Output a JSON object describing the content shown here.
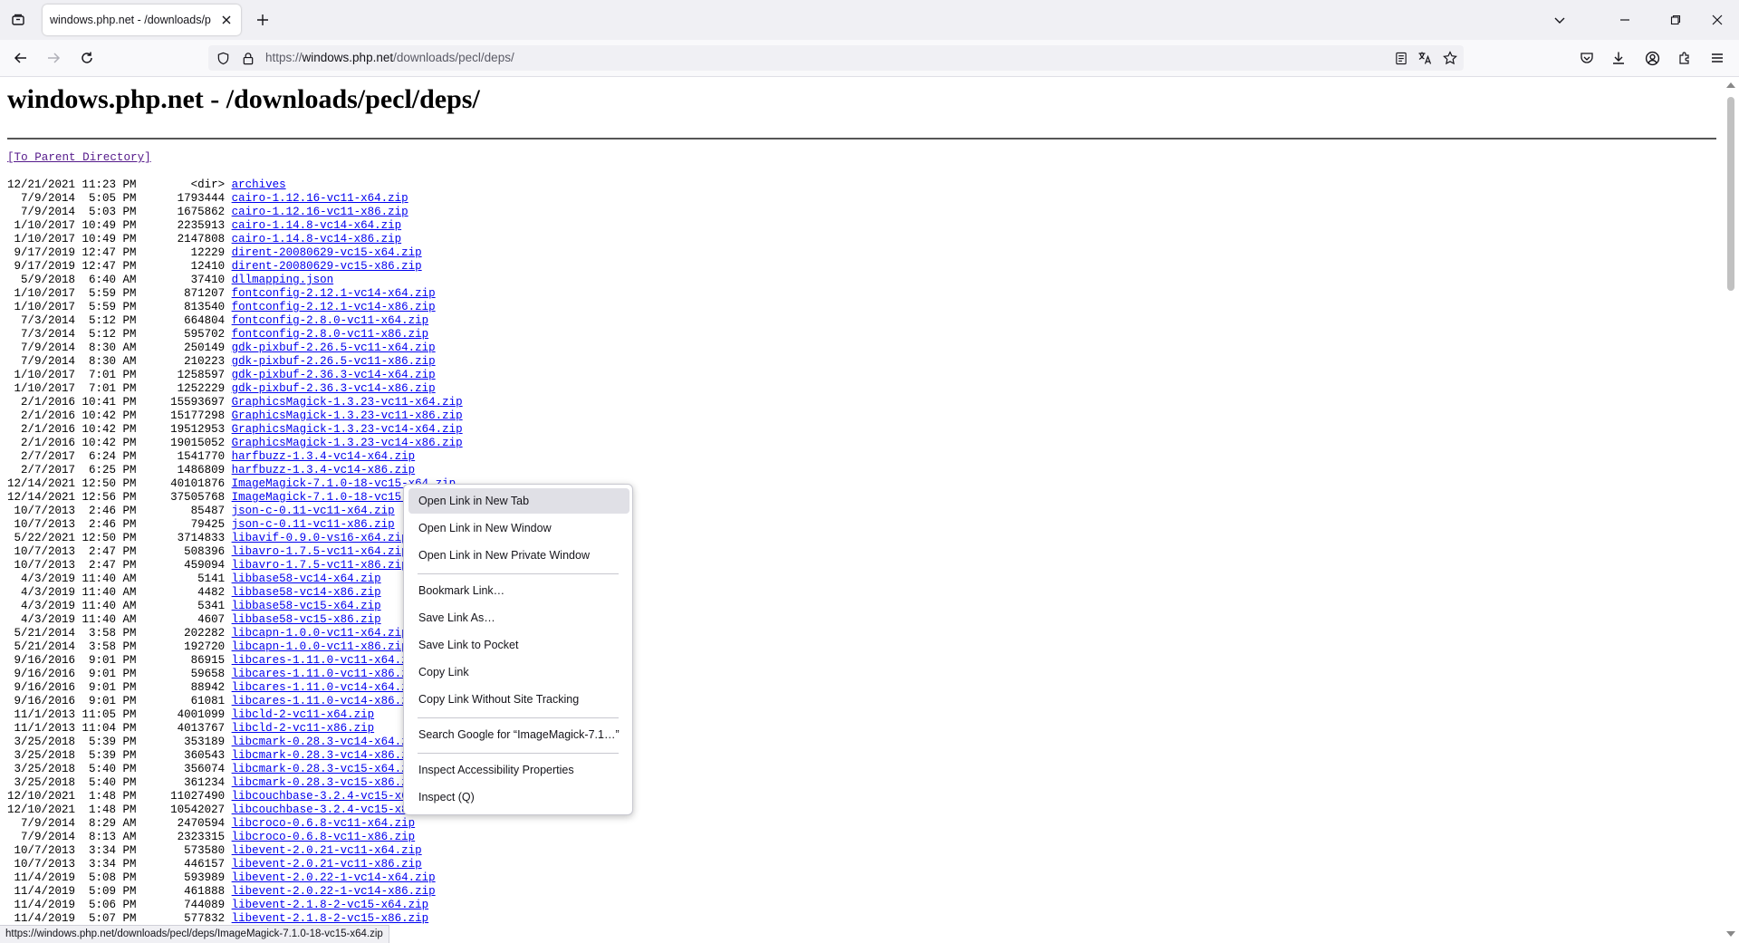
{
  "browser": {
    "tab": {
      "title": "windows.php.net - /downloads/pecl/deps/"
    },
    "url": {
      "scheme": "https://",
      "host": "windows.php.net",
      "path": "/downloads/pecl/deps/"
    }
  },
  "page": {
    "heading": "windows.php.net - /downloads/pecl/deps/",
    "parent_link": "[To Parent Directory]",
    "listing": [
      {
        "date": "12/21/2021",
        "time": "11:23 PM",
        "size": "<dir>",
        "name": "archives"
      },
      {
        "date": "7/9/2014",
        "time": "5:05 PM",
        "size": "1793444",
        "name": "cairo-1.12.16-vc11-x64.zip"
      },
      {
        "date": "7/9/2014",
        "time": "5:03 PM",
        "size": "1675862",
        "name": "cairo-1.12.16-vc11-x86.zip"
      },
      {
        "date": "1/10/2017",
        "time": "10:49 PM",
        "size": "2235913",
        "name": "cairo-1.14.8-vc14-x64.zip"
      },
      {
        "date": "1/10/2017",
        "time": "10:49 PM",
        "size": "2147808",
        "name": "cairo-1.14.8-vc14-x86.zip"
      },
      {
        "date": "9/17/2019",
        "time": "12:47 PM",
        "size": "12229",
        "name": "dirent-20080629-vc15-x64.zip"
      },
      {
        "date": "9/17/2019",
        "time": "12:47 PM",
        "size": "12410",
        "name": "dirent-20080629-vc15-x86.zip"
      },
      {
        "date": "5/9/2018",
        "time": "6:40 AM",
        "size": "37410",
        "name": "dllmapping.json"
      },
      {
        "date": "1/10/2017",
        "time": "5:59 PM",
        "size": "871207",
        "name": "fontconfig-2.12.1-vc14-x64.zip"
      },
      {
        "date": "1/10/2017",
        "time": "5:59 PM",
        "size": "813540",
        "name": "fontconfig-2.12.1-vc14-x86.zip"
      },
      {
        "date": "7/3/2014",
        "time": "5:12 PM",
        "size": "664804",
        "name": "fontconfig-2.8.0-vc11-x64.zip"
      },
      {
        "date": "7/3/2014",
        "time": "5:12 PM",
        "size": "595702",
        "name": "fontconfig-2.8.0-vc11-x86.zip"
      },
      {
        "date": "7/9/2014",
        "time": "8:30 AM",
        "size": "250149",
        "name": "gdk-pixbuf-2.26.5-vc11-x64.zip"
      },
      {
        "date": "7/9/2014",
        "time": "8:30 AM",
        "size": "210223",
        "name": "gdk-pixbuf-2.26.5-vc11-x86.zip"
      },
      {
        "date": "1/10/2017",
        "time": "7:01 PM",
        "size": "1258597",
        "name": "gdk-pixbuf-2.36.3-vc14-x64.zip"
      },
      {
        "date": "1/10/2017",
        "time": "7:01 PM",
        "size": "1252229",
        "name": "gdk-pixbuf-2.36.3-vc14-x86.zip"
      },
      {
        "date": "2/1/2016",
        "time": "10:41 PM",
        "size": "15593697",
        "name": "GraphicsMagick-1.3.23-vc11-x64.zip"
      },
      {
        "date": "2/1/2016",
        "time": "10:42 PM",
        "size": "15177298",
        "name": "GraphicsMagick-1.3.23-vc11-x86.zip"
      },
      {
        "date": "2/1/2016",
        "time": "10:42 PM",
        "size": "19512953",
        "name": "GraphicsMagick-1.3.23-vc14-x64.zip"
      },
      {
        "date": "2/1/2016",
        "time": "10:42 PM",
        "size": "19015052",
        "name": "GraphicsMagick-1.3.23-vc14-x86.zip"
      },
      {
        "date": "2/7/2017",
        "time": "6:24 PM",
        "size": "1541770",
        "name": "harfbuzz-1.3.4-vc14-x64.zip"
      },
      {
        "date": "2/7/2017",
        "time": "6:25 PM",
        "size": "1486809",
        "name": "harfbuzz-1.3.4-vc14-x86.zip"
      },
      {
        "date": "12/14/2021",
        "time": "12:50 PM",
        "size": "40101876",
        "name": "ImageMagick-7.1.0-18-vc15-x64.zip"
      },
      {
        "date": "12/14/2021",
        "time": "12:56 PM",
        "size": "37505768",
        "name": "ImageMagick-7.1.0-18-vc15-x86.zip"
      },
      {
        "date": "10/7/2013",
        "time": "2:46 PM",
        "size": "85487",
        "name": "json-c-0.11-vc11-x64.zip"
      },
      {
        "date": "10/7/2013",
        "time": "2:46 PM",
        "size": "79425",
        "name": "json-c-0.11-vc11-x86.zip"
      },
      {
        "date": "5/22/2021",
        "time": "12:50 PM",
        "size": "3714833",
        "name": "libavif-0.9.0-vs16-x64.zip"
      },
      {
        "date": "10/7/2013",
        "time": "2:47 PM",
        "size": "508396",
        "name": "libavro-1.7.5-vc11-x64.zip"
      },
      {
        "date": "10/7/2013",
        "time": "2:47 PM",
        "size": "459094",
        "name": "libavro-1.7.5-vc11-x86.zip"
      },
      {
        "date": "4/3/2019",
        "time": "11:40 AM",
        "size": "5141",
        "name": "libbase58-vc14-x64.zip"
      },
      {
        "date": "4/3/2019",
        "time": "11:40 AM",
        "size": "4482",
        "name": "libbase58-vc14-x86.zip"
      },
      {
        "date": "4/3/2019",
        "time": "11:40 AM",
        "size": "5341",
        "name": "libbase58-vc15-x64.zip"
      },
      {
        "date": "4/3/2019",
        "time": "11:40 AM",
        "size": "4607",
        "name": "libbase58-vc15-x86.zip"
      },
      {
        "date": "5/21/2014",
        "time": "3:58 PM",
        "size": "202282",
        "name": "libcapn-1.0.0-vc11-x64.zip"
      },
      {
        "date": "5/21/2014",
        "time": "3:58 PM",
        "size": "192720",
        "name": "libcapn-1.0.0-vc11-x86.zip"
      },
      {
        "date": "9/16/2016",
        "time": "9:01 PM",
        "size": "86915",
        "name": "libcares-1.11.0-vc11-x64.zip"
      },
      {
        "date": "9/16/2016",
        "time": "9:01 PM",
        "size": "59658",
        "name": "libcares-1.11.0-vc11-x86.zip"
      },
      {
        "date": "9/16/2016",
        "time": "9:01 PM",
        "size": "88942",
        "name": "libcares-1.11.0-vc14-x64.zip"
      },
      {
        "date": "9/16/2016",
        "time": "9:01 PM",
        "size": "61081",
        "name": "libcares-1.11.0-vc14-x86.zip"
      },
      {
        "date": "11/1/2013",
        "time": "11:05 PM",
        "size": "4001099",
        "name": "libcld-2-vc11-x64.zip"
      },
      {
        "date": "11/1/2013",
        "time": "11:04 PM",
        "size": "4013767",
        "name": "libcld-2-vc11-x86.zip"
      },
      {
        "date": "3/25/2018",
        "time": "5:39 PM",
        "size": "353189",
        "name": "libcmark-0.28.3-vc14-x64.zip"
      },
      {
        "date": "3/25/2018",
        "time": "5:39 PM",
        "size": "360543",
        "name": "libcmark-0.28.3-vc14-x86.zip"
      },
      {
        "date": "3/25/2018",
        "time": "5:40 PM",
        "size": "356074",
        "name": "libcmark-0.28.3-vc15-x64.zip"
      },
      {
        "date": "3/25/2018",
        "time": "5:40 PM",
        "size": "361234",
        "name": "libcmark-0.28.3-vc15-x86.zip"
      },
      {
        "date": "12/10/2021",
        "time": "1:48 PM",
        "size": "11027490",
        "name": "libcouchbase-3.2.4-vc15-x64.zip"
      },
      {
        "date": "12/10/2021",
        "time": "1:48 PM",
        "size": "10542027",
        "name": "libcouchbase-3.2.4-vc15-x86.zip"
      },
      {
        "date": "7/9/2014",
        "time": "8:29 AM",
        "size": "2470594",
        "name": "libcroco-0.6.8-vc11-x64.zip"
      },
      {
        "date": "7/9/2014",
        "time": "8:13 AM",
        "size": "2323315",
        "name": "libcroco-0.6.8-vc11-x86.zip"
      },
      {
        "date": "10/7/2013",
        "time": "3:34 PM",
        "size": "573580",
        "name": "libevent-2.0.21-vc11-x64.zip"
      },
      {
        "date": "10/7/2013",
        "time": "3:34 PM",
        "size": "446157",
        "name": "libevent-2.0.21-vc11-x86.zip"
      },
      {
        "date": "11/4/2019",
        "time": "5:08 PM",
        "size": "593989",
        "name": "libevent-2.0.22-1-vc14-x64.zip"
      },
      {
        "date": "11/4/2019",
        "time": "5:09 PM",
        "size": "461888",
        "name": "libevent-2.0.22-1-vc14-x86.zip"
      },
      {
        "date": "11/4/2019",
        "time": "5:06 PM",
        "size": "744089",
        "name": "libevent-2.1.8-2-vc15-x64.zip"
      },
      {
        "date": "11/4/2019",
        "time": "5:07 PM",
        "size": "577832",
        "name": "libevent-2.1.8-2-vc15-x86.zip"
      }
    ]
  },
  "context_menu": {
    "open_new_tab": "Open Link in New Tab",
    "open_new_window": "Open Link in New Window",
    "open_private_window": "Open Link in New Private Window",
    "bookmark_link": "Bookmark Link…",
    "save_link_as": "Save Link As…",
    "save_to_pocket": "Save Link to Pocket",
    "copy_link": "Copy Link",
    "copy_without_tracking": "Copy Link Without Site Tracking",
    "search_google": "Search Google for “ImageMagick-7.1…”",
    "inspect_accessibility": "Inspect Accessibility Properties",
    "inspect": "Inspect (Q)"
  },
  "status_bar": {
    "url": "https://windows.php.net/downloads/pecl/deps/ImageMagick-7.1.0-18-vc15-x64.zip"
  },
  "icons": [
    "tab-list-icon",
    "tab-close-icon",
    "new-tab-icon",
    "list-all-tabs-icon",
    "minimize-icon",
    "restore-icon",
    "close-window-icon",
    "back-icon",
    "forward-icon",
    "reload-icon",
    "tracking-shield-icon",
    "lock-icon",
    "reader-view-icon",
    "translate-icon",
    "bookmark-star-icon",
    "pocket-icon",
    "downloads-icon",
    "account-icon",
    "extensions-icon",
    "app-menu-icon"
  ]
}
